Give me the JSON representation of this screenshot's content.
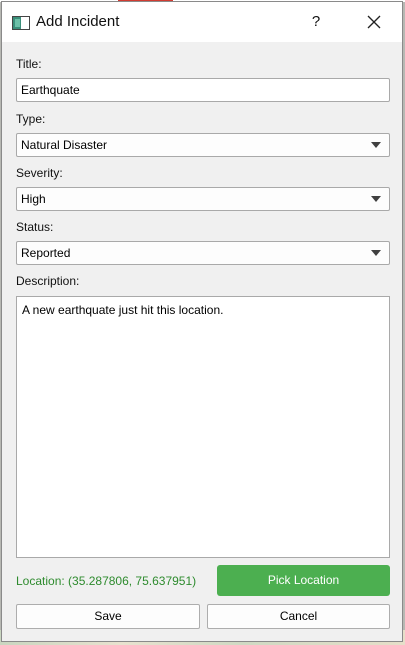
{
  "window": {
    "title": "Add Incident",
    "help_glyph": "?",
    "icon": "app-window-icon",
    "close_icon": "close-icon"
  },
  "form": {
    "title_label": "Title:",
    "title_value": "Earthquate",
    "type_label": "Type:",
    "type_value": "Natural Disaster",
    "severity_label": "Severity:",
    "severity_value": "High",
    "status_label": "Status:",
    "status_value": "Reported",
    "description_label": "Description:",
    "description_value": "A new earthquate just hit this location."
  },
  "location": {
    "text": "Location: (35.287806, 75.637951)",
    "pick_label": "Pick Location"
  },
  "actions": {
    "save_label": "Save",
    "cancel_label": "Cancel"
  },
  "colors": {
    "location_text": "#2e8b2e",
    "pick_button": "#4caf50"
  }
}
